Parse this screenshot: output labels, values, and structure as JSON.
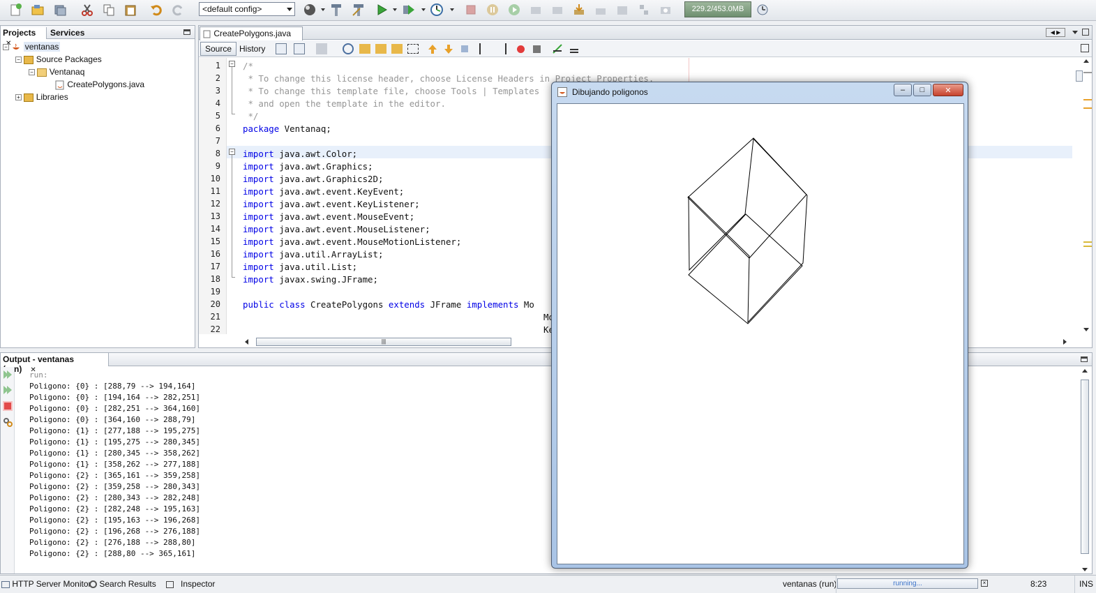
{
  "toolbar": {
    "config_value": "<default config>",
    "memory": "229.2/453.0MB",
    "icons": [
      "new-file-icon",
      "new-project-icon",
      "open-project-icon",
      "save-all-icon",
      "cut-icon",
      "copy-icon",
      "paste-icon",
      "undo-icon",
      "redo-icon",
      "build-icon",
      "clean-build-icon",
      "run-icon",
      "debug-icon",
      "profile-icon",
      "stop-icon",
      "pause-icon",
      "continue-icon",
      "gc-icon"
    ]
  },
  "projects": {
    "tab_projects": "Projects",
    "tab_services": "Services",
    "tree": {
      "root": "ventanas",
      "source_packages": "Source Packages",
      "package": "Ventanaq",
      "file": "CreatePolygons.java",
      "libraries": "Libraries"
    }
  },
  "editor": {
    "tab_title": "CreatePolygons.java",
    "source_label": "Source",
    "history_label": "History",
    "line_numbers": [
      "1",
      "2",
      "3",
      "4",
      "5",
      "6",
      "7",
      "8",
      "9",
      "10",
      "11",
      "12",
      "13",
      "14",
      "15",
      "16",
      "17",
      "18",
      "19",
      "20",
      "21",
      "22"
    ],
    "lines": {
      "l1": "/*",
      "l2": " * To change this license header, choose License Headers in Project Properties.",
      "l3": " * To change this template file, choose Tools | Templates",
      "l4": " * and open the template in the editor.",
      "l5": " */",
      "l6_kw": "package",
      "l6_rest": " Ventanaq;",
      "import_kw": "import",
      "imports": [
        " java.awt.Color;",
        " java.awt.Graphics;",
        " java.awt.Graphics2D;",
        " java.awt.event.KeyEvent;",
        " java.awt.event.KeyListener;",
        " java.awt.event.MouseEvent;",
        " java.awt.event.MouseListener;",
        " java.awt.event.MouseMotionListener;",
        " java.util.ArrayList;",
        " java.util.List;",
        " javax.swing.JFrame;"
      ],
      "l20_public": "public",
      "l20_class": "class",
      "l20_name": " CreatePolygons ",
      "l20_extends": "extends",
      "l20_jframe": " JFrame ",
      "l20_implements": "implements",
      "l20_tail": " Mo",
      "l21_tail": "Mo",
      "l22_tail": "Ke"
    }
  },
  "output": {
    "title": "Output - ventanas (run)",
    "lines": [
      "run:",
      "Poligono: {0} : [288,79 --> 194,164]",
      "Poligono: {0} : [194,164 --> 282,251]",
      "Poligono: {0} : [282,251 --> 364,160]",
      "Poligono: {0} : [364,160 --> 288,79]",
      "Poligono: {1} : [277,188 --> 195,275]",
      "Poligono: {1} : [195,275 --> 280,345]",
      "Poligono: {1} : [280,345 --> 358,262]",
      "Poligono: {1} : [358,262 --> 277,188]",
      "Poligono: {2} : [365,161 --> 359,258]",
      "Poligono: {2} : [359,258 --> 280,343]",
      "Poligono: {2} : [280,343 --> 282,248]",
      "Poligono: {2} : [282,248 --> 195,163]",
      "Poligono: {2} : [195,163 --> 196,268]",
      "Poligono: {2} : [196,268 --> 276,188]",
      "Poligono: {2} : [276,188 --> 288,80]",
      "Poligono: {2} : [288,80 --> 365,161]"
    ]
  },
  "dialog": {
    "title": "Dibujando poligonos",
    "min_label": "–",
    "max_label": "□",
    "close_label": "✕"
  },
  "status": {
    "http_monitor": "HTTP Server Monitor",
    "search_results": "Search Results",
    "inspector": "Inspector",
    "run_label": "ventanas (run)",
    "progress_text": "running...",
    "time": "8:23",
    "mode": "INS"
  },
  "colors": {
    "keyword": "#0000e6",
    "comment": "#969696",
    "selection_line": "#e8f0fb"
  }
}
